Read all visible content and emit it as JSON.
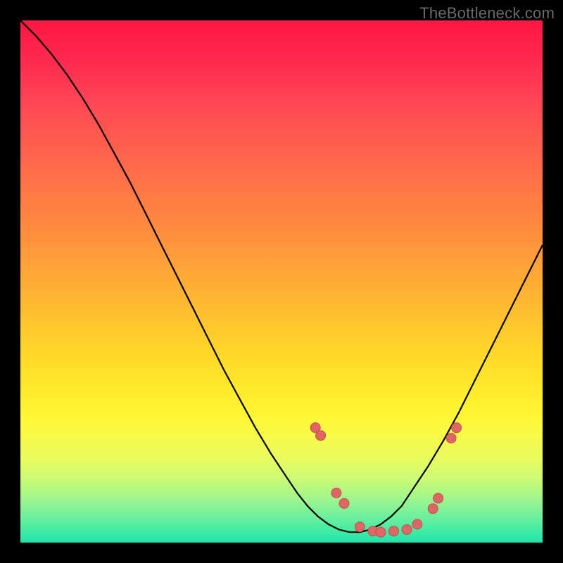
{
  "watermark": "TheBottleneck.com",
  "chart_data": {
    "type": "line",
    "title": "",
    "xlabel": "",
    "ylabel": "",
    "xlim": [
      0,
      100
    ],
    "ylim": [
      0,
      100
    ],
    "series": [
      {
        "name": "curve",
        "x": [
          0,
          3,
          6,
          9,
          12,
          15,
          18,
          21,
          24,
          27,
          30,
          33,
          36,
          39,
          42,
          45,
          48,
          51,
          53,
          55,
          57,
          59,
          61,
          63,
          65,
          67,
          69,
          71,
          73,
          75,
          78,
          81,
          84,
          87,
          90,
          93,
          96,
          100
        ],
        "values": [
          100,
          97,
          93.5,
          89.5,
          85,
          80,
          74.5,
          69,
          63,
          57,
          51,
          45,
          39,
          33,
          27.5,
          22,
          17,
          12.5,
          9.5,
          7,
          5,
          3.5,
          2.5,
          2,
          2,
          2.5,
          3.5,
          5,
          7,
          10,
          14.5,
          19.5,
          25,
          31,
          37,
          43,
          49,
          57
        ]
      }
    ],
    "markers": {
      "name": "dots",
      "x": [
        56.5,
        57.5,
        60.5,
        62,
        65,
        67.5,
        69,
        71.5,
        74,
        76,
        79,
        80,
        82.5,
        83.5
      ],
      "values": [
        22,
        20.5,
        9.5,
        7.5,
        3,
        2.2,
        2,
        2.2,
        2.5,
        3.5,
        6.5,
        8.5,
        20,
        22
      ]
    },
    "background_gradient": {
      "top": "#ff1744",
      "mid": "#ffd22a",
      "bottom": "#1ee6aa"
    }
  }
}
